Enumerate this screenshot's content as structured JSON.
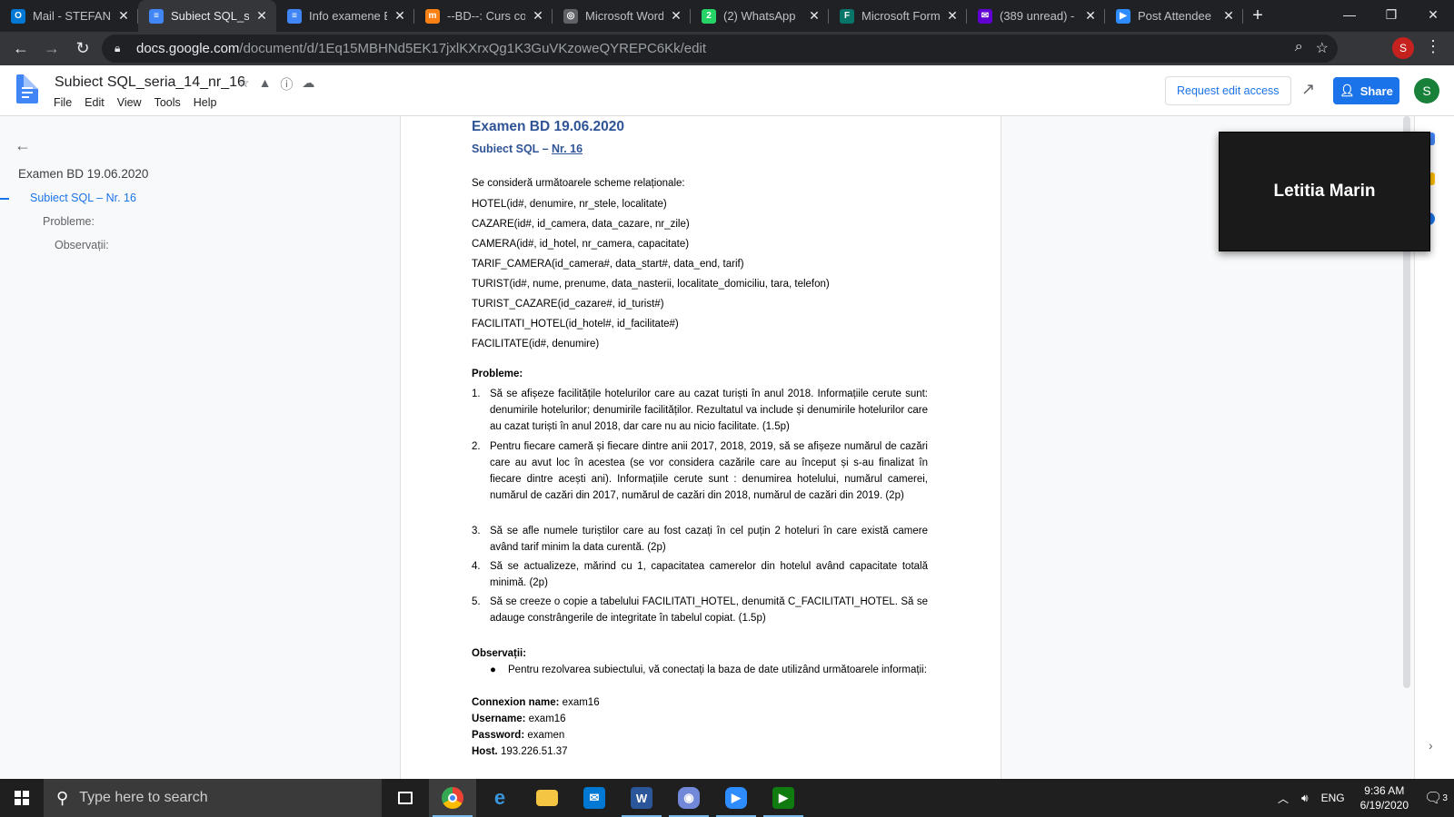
{
  "browser": {
    "tabs": [
      {
        "title": "Mail - STEFANI",
        "icon": "outlook-icon",
        "color": "#0078d4",
        "glyph": "O"
      },
      {
        "title": "Subiect SQL_se",
        "icon": "google-docs-icon",
        "color": "#4285f4",
        "glyph": "≡",
        "active": true
      },
      {
        "title": "Info examene B",
        "icon": "google-docs-icon",
        "color": "#4285f4",
        "glyph": "≡"
      },
      {
        "title": "--BD--: Curs co",
        "icon": "moodle-icon",
        "color": "#f98012",
        "glyph": "m"
      },
      {
        "title": "Microsoft Word",
        "icon": "globe-icon",
        "color": "#5f6368",
        "glyph": "◎"
      },
      {
        "title": "(2) WhatsApp",
        "icon": "whatsapp-icon",
        "color": "#25d366",
        "glyph": "2"
      },
      {
        "title": "Microsoft Form",
        "icon": "forms-icon",
        "color": "#077568",
        "glyph": "F"
      },
      {
        "title": "(389 unread) -",
        "icon": "yahoo-mail-icon",
        "color": "#6001d2",
        "glyph": "✉"
      },
      {
        "title": "Post Attendee",
        "icon": "zoom-icon",
        "color": "#2d8cff",
        "glyph": "▶"
      }
    ],
    "url_host": "docs.google.com",
    "url_path": "/document/d/1Eq15MBHNd5EK17jxlKXrxQg1K3GuVKzoweQYREPC6Kk/edit",
    "profile_initial": "S"
  },
  "docs": {
    "title": "Subiect SQL_seria_14_nr_16",
    "menu": [
      "File",
      "Edit",
      "View",
      "Tools",
      "Help"
    ],
    "request_edit": "Request edit access",
    "share": "Share",
    "avatar_initial": "S"
  },
  "outline": {
    "h1": "Examen BD 19.06.2020",
    "h2": "Subiect SQL – Nr. 16",
    "h3a": "Probleme:",
    "h3b": "Observații:"
  },
  "document": {
    "heading": "Examen BD 19.06.2020",
    "subheading_prefix": "Subiect SQL – ",
    "subheading_link": "Nr. 16",
    "intro": "Se consideră următoarele scheme relaționale:",
    "schemas": [
      "HOTEL(id#, denumire, nr_stele, localitate)",
      "CAZARE(id#, id_camera, data_cazare, nr_zile)",
      "CAMERA(id#, id_hotel, nr_camera, capacitate)",
      "TARIF_CAMERA(id_camera#, data_start#, data_end, tarif)",
      "TURIST(id#, nume, prenume, data_nasterii, localitate_domiciliu, tara, telefon)",
      "TURIST_CAZARE(id_cazare#, id_turist#)",
      "FACILITATI_HOTEL(id_hotel#, id_facilitate#)",
      "FACILITATE(id#, denumire)"
    ],
    "problems_title": "Probleme:",
    "problems": [
      {
        "num": "1.",
        "text": "Să se afișeze facilitățile hotelurilor care au cazat turiști în anul 2018. Informațiile cerute sunt: denumirile hotelurilor; denumirile facilităților. Rezultatul va include și denumirile hotelurilor care au cazat turiști în anul 2018, dar care nu au nicio facilitate. (1.5p)"
      },
      {
        "num": "2.",
        "text": "Pentru fiecare cameră și fiecare dintre anii 2017, 2018, 2019, să se afișeze numărul de cazări care au avut loc în acestea (se vor considera cazările care au început și s-au finalizat în fiecare dintre acești ani). Informațiile cerute sunt : denumirea hotelului, numărul camerei, numărul de cazări din 2017, numărul de cazări din 2018, numărul de cazări din 2019. (2p)"
      },
      {
        "num": "3.",
        "text": "Să se afle numele turiștilor care au fost cazați în cel puțin 2 hoteluri în care există camere având tarif minim la data curentă. (2p)"
      },
      {
        "num": "4.",
        "text": "Să se actualizeze, mărind cu 1, capacitatea camerelor din hotelul având capacitate totală minimă. (2p)"
      },
      {
        "num": "5.",
        "text": "Să se creeze o copie a tabelului FACILITATI_HOTEL, denumită C_FACILITATI_HOTEL. Să se adauge constrângerile de integritate în tabelul copiat. (1.5p)"
      }
    ],
    "observations_title": "Observații:",
    "observation_bullet": "Pentru rezolvarea subiectului, vă conectați la baza de date utilizând următoarele informații:",
    "connection": [
      {
        "label": "Connexion name:",
        "value": " exam16"
      },
      {
        "label": "Username:",
        "value": " exam16"
      },
      {
        "label": "Password:",
        "value": " examen"
      },
      {
        "label": "Host.",
        "value": " 193.226.51.37"
      }
    ]
  },
  "zoom": {
    "participant_name": "Letitia Marin"
  },
  "taskbar": {
    "search_placeholder": "Type here to search",
    "language": "ENG",
    "time": "9:36 AM",
    "date": "6/19/2020",
    "notification_count": "3"
  }
}
